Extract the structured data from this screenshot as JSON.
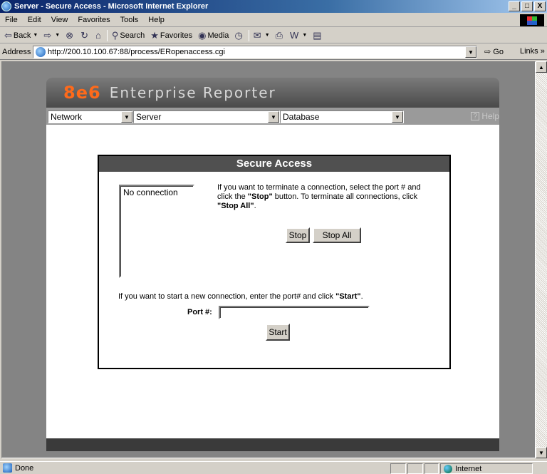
{
  "window": {
    "title": "Server - Secure Access - Microsoft Internet Explorer",
    "minimize": "_",
    "maximize": "□",
    "close": "X"
  },
  "menu": [
    "File",
    "Edit",
    "View",
    "Favorites",
    "Tools",
    "Help"
  ],
  "toolbar": {
    "back": "Back",
    "search": "Search",
    "favorites": "Favorites",
    "media": "Media"
  },
  "address": {
    "label": "Address",
    "url": "http://200.10.100.67:88/process/ERopenaccess.cgi",
    "go": "Go",
    "links": "Links »"
  },
  "page": {
    "logo": "8e6",
    "product": "Enterprise Reporter",
    "nav": {
      "network": "Network",
      "server": "Server",
      "database": "Database",
      "help": "Help"
    },
    "panel": {
      "title": "Secure Access",
      "connection_list": [
        "No connection"
      ],
      "instr_part1": "If you want to terminate a connection, select the port # and click the ",
      "instr_stop": "\"Stop\"",
      "instr_part2": " button. To terminate all connections, click ",
      "instr_stop_all": "\"Stop All\"",
      "instr_end": ".",
      "stop_button": "Stop",
      "stop_all_button": "Stop All",
      "start_instr": "If you want to start a new connection, enter the port# and click ",
      "start_instr_bold": "\"Start\"",
      "start_instr_end": ".",
      "port_label": "Port #:",
      "port_value": "",
      "start_button": "Start"
    }
  },
  "status": {
    "text": "Done",
    "zone": "Internet"
  }
}
